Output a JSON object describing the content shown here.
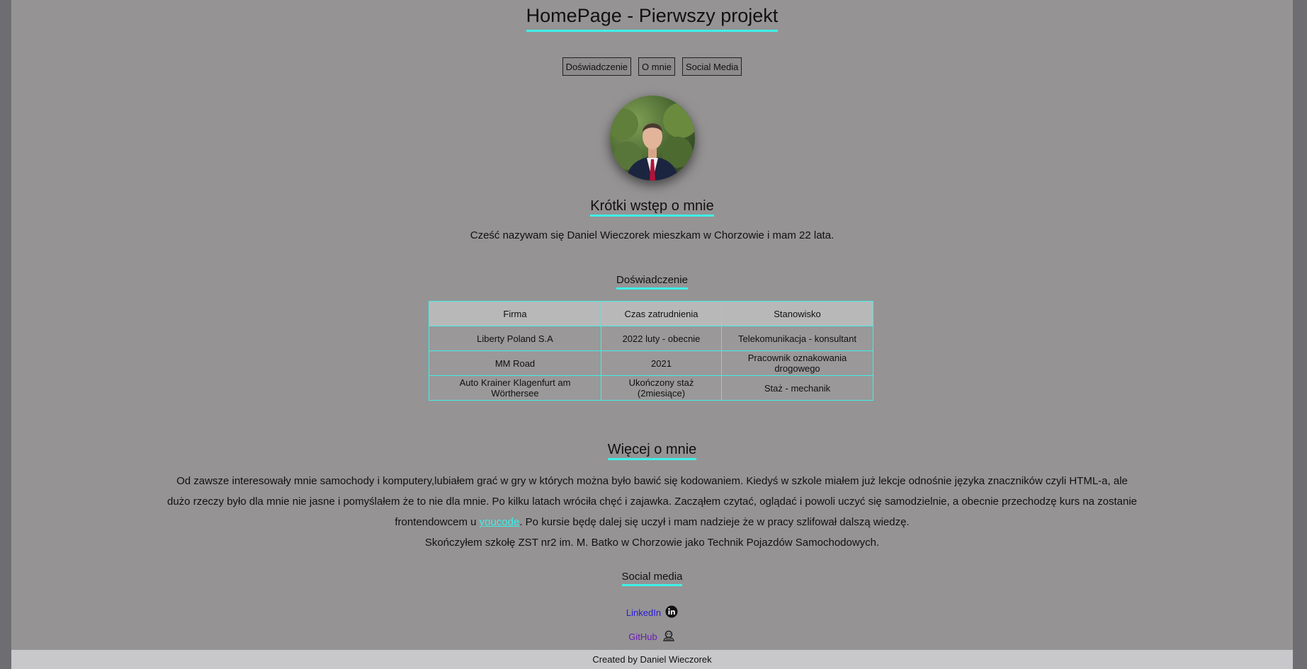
{
  "header": {
    "title": "HomePage - Pierwszy projekt"
  },
  "nav": {
    "items": [
      {
        "label": "Doświadczenie"
      },
      {
        "label": "O mnie"
      },
      {
        "label": "Social Media"
      }
    ]
  },
  "intro": {
    "heading": "Krótki wstęp o mnie",
    "text": "Cześć nazywam się Daniel Wieczorek mieszkam w Chorzowie i mam 22 lata."
  },
  "experience": {
    "heading": "Doświadczenie",
    "columns": [
      "Firma",
      "Czas zatrudnienia",
      "Stanowisko"
    ],
    "rows": [
      [
        "Liberty Poland S.A",
        "2022 luty - obecnie",
        "Telekomunikacja - konsultant"
      ],
      [
        "MM Road",
        "2021",
        "Pracownik oznakowania drogowego"
      ],
      [
        "Auto Krainer Klagenfurt am Wörthersee",
        "Ukończony staż (2miesiące)",
        "Staż - mechanik"
      ]
    ]
  },
  "about": {
    "heading": "Więcej o mnie",
    "paragraph_before_link": "Od zawsze interesowały mnie samochody i komputery,lubiałem grać w gry w których można było bawić się kodowaniem. Kiedyś w szkole miałem już lekcje odnośnie języka znaczników czyli HTML-a, ale dużo rzeczy było dla mnie nie jasne i pomyślałem że to nie dla mnie. Po kilku latach wróciła chęć i zajawka. Zacząłem czytać, oglądać i powoli uczyć się samodzielnie, a obecnie przechodzę kurs na zostanie frontendowcem u ",
    "link_label": "youcode",
    "paragraph_after_link": ". Po kursie będę dalej się uczył i mam nadzieje że w pracy szlifował dalszą wiedzę.",
    "school": "Skończyłem szkołę ZST nr2 im. M. Batko w Chorzowie jako Technik Pojazdów Samochodowych."
  },
  "social": {
    "heading": "Social media",
    "links": [
      {
        "label": "LinkedIn",
        "icon": "linkedin-icon",
        "color": "#2a1ad8"
      },
      {
        "label": "GitHub",
        "icon": "github-icon",
        "color": "#6a1ab8"
      }
    ]
  },
  "footer": {
    "text": "Created by Daniel Wieczorek"
  },
  "colors": {
    "accent": "#3ff0e8",
    "page_bg": "#959394",
    "footer_bg": "#c8c8cb"
  }
}
